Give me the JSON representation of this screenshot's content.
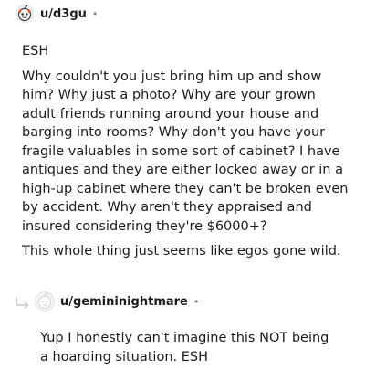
{
  "comment1": {
    "username": "u/d3gu",
    "dot": "•",
    "paragraphs": [
      "ESH",
      "Why couldn't you just bring him up and show him? Why just a photo? Why are your grown adult friends running around your house and barging into rooms? Why don't you have your fragile valuables in some sort of cabinet? I have antiques and they are either locked away or in a high-up cabinet where they can't be broken even by accident. Why aren't they appraised and insured considering they're $6000+?",
      "This whole thing just seems like egos gone wild."
    ]
  },
  "comment2": {
    "username": "u/gemininightmare",
    "dot": "•",
    "paragraphs": [
      "Yup I honestly can't imagine this NOT being a hoarding situation. ESH"
    ]
  }
}
